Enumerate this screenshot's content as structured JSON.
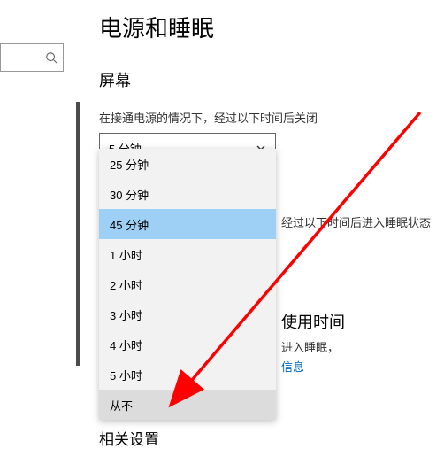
{
  "page_title": "电源和睡眠",
  "search": {
    "placeholder": ""
  },
  "section_screen": "屏幕",
  "screen_off_desc": "在接通电源的情况下，经过以下时间后关闭",
  "select_value": "5 分钟",
  "dropdown": {
    "items": [
      {
        "label": "25 分钟"
      },
      {
        "label": "30 分钟"
      },
      {
        "label": "45 分钟",
        "selected": true
      },
      {
        "label": "1 小时"
      },
      {
        "label": "2 小时"
      },
      {
        "label": "3 小时"
      },
      {
        "label": "4 小时"
      },
      {
        "label": "5 小时"
      },
      {
        "label": "从不",
        "hover": true
      }
    ]
  },
  "sleep_desc": "经过以下时间后进入睡眠状态",
  "usage_title": "使用时间",
  "usage_line1": "进入睡眠，",
  "usage_link": "信息",
  "related_title": "相关设置",
  "colors": {
    "highlight": "#9ecff4",
    "hover": "#dcdcdc",
    "arrow": "#ff0000",
    "link": "#0067c0"
  }
}
